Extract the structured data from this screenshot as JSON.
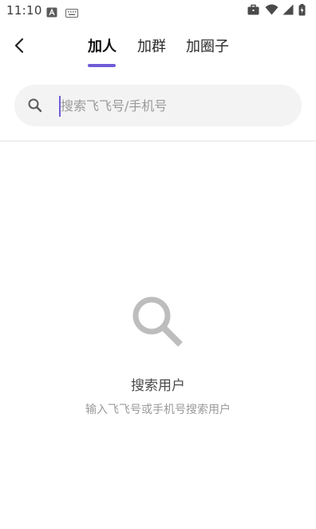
{
  "status_bar": {
    "time": "11:10",
    "left_icons": [
      "font-a-icon",
      "keyboard-icon"
    ],
    "right_icons": [
      "briefcase-icon",
      "wifi-icon",
      "signal-icon",
      "battery-charging-icon"
    ]
  },
  "header": {
    "back_icon": "chevron-left-icon",
    "tabs": [
      {
        "label": "加人",
        "active": true
      },
      {
        "label": "加群",
        "active": false
      },
      {
        "label": "加圈子",
        "active": false
      }
    ],
    "accent_color": "#6f5cd6"
  },
  "search": {
    "icon": "search-icon",
    "placeholder": "搜索飞飞号/手机号",
    "value": ""
  },
  "empty_state": {
    "icon": "magnifier-icon",
    "title": "搜索用户",
    "subtitle": "输入飞飞号或手机号搜索用户"
  }
}
